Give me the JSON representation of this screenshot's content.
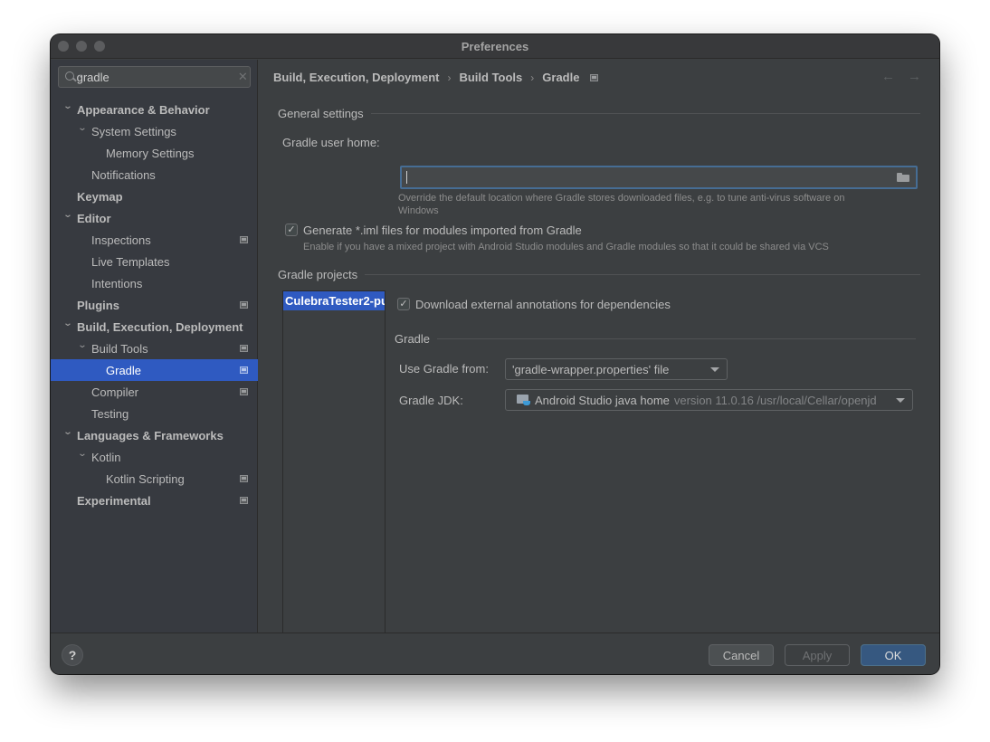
{
  "window": {
    "title": "Preferences"
  },
  "sidebar": {
    "search": {
      "value": "gradle",
      "placeholder": ""
    },
    "items": [
      {
        "label": "Appearance & Behavior",
        "level": 0,
        "bold": true,
        "expanded": true,
        "badge": false,
        "selected": false
      },
      {
        "label": "System Settings",
        "level": 1,
        "bold": false,
        "expanded": true,
        "badge": false,
        "selected": false
      },
      {
        "label": "Memory Settings",
        "level": 2,
        "bold": false,
        "expanded": null,
        "badge": false,
        "selected": false
      },
      {
        "label": "Notifications",
        "level": 1,
        "bold": false,
        "expanded": null,
        "badge": false,
        "selected": false
      },
      {
        "label": "Keymap",
        "level": 0,
        "bold": true,
        "expanded": null,
        "badge": false,
        "selected": false
      },
      {
        "label": "Editor",
        "level": 0,
        "bold": true,
        "expanded": true,
        "badge": false,
        "selected": false
      },
      {
        "label": "Inspections",
        "level": 1,
        "bold": false,
        "expanded": null,
        "badge": true,
        "selected": false
      },
      {
        "label": "Live Templates",
        "level": 1,
        "bold": false,
        "expanded": null,
        "badge": false,
        "selected": false
      },
      {
        "label": "Intentions",
        "level": 1,
        "bold": false,
        "expanded": null,
        "badge": false,
        "selected": false
      },
      {
        "label": "Plugins",
        "level": 0,
        "bold": true,
        "expanded": null,
        "badge": true,
        "selected": false
      },
      {
        "label": "Build, Execution, Deployment",
        "level": 0,
        "bold": true,
        "expanded": true,
        "badge": false,
        "selected": false
      },
      {
        "label": "Build Tools",
        "level": 1,
        "bold": false,
        "expanded": true,
        "badge": true,
        "selected": false
      },
      {
        "label": "Gradle",
        "level": 2,
        "bold": false,
        "expanded": null,
        "badge": true,
        "selected": true
      },
      {
        "label": "Compiler",
        "level": 1,
        "bold": false,
        "expanded": null,
        "badge": true,
        "selected": false
      },
      {
        "label": "Testing",
        "level": 1,
        "bold": false,
        "expanded": null,
        "badge": false,
        "selected": false
      },
      {
        "label": "Languages & Frameworks",
        "level": 0,
        "bold": true,
        "expanded": true,
        "badge": false,
        "selected": false
      },
      {
        "label": "Kotlin",
        "level": 1,
        "bold": false,
        "expanded": true,
        "badge": false,
        "selected": false
      },
      {
        "label": "Kotlin Scripting",
        "level": 2,
        "bold": false,
        "expanded": null,
        "badge": true,
        "selected": false
      },
      {
        "label": "Experimental",
        "level": 0,
        "bold": true,
        "expanded": null,
        "badge": true,
        "selected": false
      }
    ]
  },
  "main": {
    "breadcrumb": [
      "Build, Execution, Deployment",
      "Build Tools",
      "Gradle"
    ],
    "breadcrumb_separator": "›",
    "nav": {
      "back": "←",
      "forward": "→"
    },
    "general": {
      "title": "General settings",
      "user_home_label": "Gradle user home:",
      "user_home_value": "",
      "user_home_hint_line1": "Override the default location where Gradle stores downloaded files, e.g. to tune anti-virus software on",
      "user_home_hint_line2": "Windows",
      "generate_iml": {
        "checked": true,
        "label": "Generate *.iml files for modules imported from Gradle",
        "hint": "Enable if you have a mixed project with Android Studio modules and Gradle modules so that it could be shared via VCS"
      }
    },
    "projects": {
      "title": "Gradle projects",
      "list": [
        "CulebraTester2-pu"
      ],
      "download_annotations": {
        "checked": true,
        "label": "Download external annotations for dependencies"
      },
      "gradle_section_title": "Gradle",
      "use_gradle_from_label": "Use Gradle from:",
      "use_gradle_from_value": "'gradle-wrapper.properties' file",
      "jdk_label": "Gradle JDK:",
      "jdk_name": "Android Studio java home",
      "jdk_detail": "version 11.0.16 /usr/local/Cellar/openjd"
    }
  },
  "footer": {
    "help": "?",
    "cancel": "Cancel",
    "apply": "Apply",
    "ok": "OK"
  },
  "colors": {
    "selection": "#2f5ac1",
    "ok_button": "#365880",
    "focus_border": "#466d94"
  }
}
